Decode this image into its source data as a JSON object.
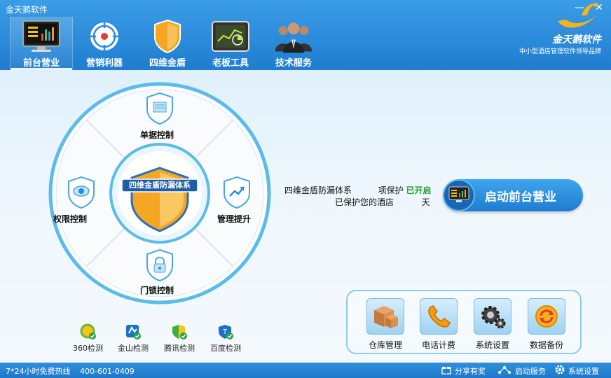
{
  "window": {
    "title": "金天鹅软件",
    "min_symbol": "—",
    "close_symbol": "✕"
  },
  "nav": {
    "tabs": [
      {
        "label": "前台营业",
        "icon": "monitor-chart-icon",
        "active": true
      },
      {
        "label": "营销利器",
        "icon": "target-icon",
        "active": false
      },
      {
        "label": "四维金盾",
        "icon": "shield-icon",
        "active": false
      },
      {
        "label": "老板工具",
        "icon": "dashboard-chart-icon",
        "active": false
      },
      {
        "label": "技术服务",
        "icon": "people-icon",
        "active": false
      }
    ]
  },
  "brand": {
    "name": "金天鹅软件",
    "slogan": "中小型酒店管理软件领导品牌"
  },
  "wheel": {
    "center_title": "四维金盾防漏体系",
    "top_label": "单据控制",
    "left_label": "权限控制",
    "right_label": "管理提升",
    "bottom_label": "门锁控制"
  },
  "status": {
    "line1_prefix": "四维金盾防漏体系",
    "line1_mid": "项保护",
    "line1_state": "已开启",
    "line2_prefix": "已保护您的酒店",
    "line2_suffix": "天"
  },
  "start_button": {
    "label": "启动前台营业"
  },
  "tools": [
    {
      "label": "仓库管理",
      "icon": "boxes-icon"
    },
    {
      "label": "电话计费",
      "icon": "phone-icon"
    },
    {
      "label": "系统设置",
      "icon": "gears-icon"
    },
    {
      "label": "数据备份",
      "icon": "refresh-icon"
    }
  ],
  "checks": [
    {
      "label": "360检测",
      "icon": "360-check-icon"
    },
    {
      "label": "金山检测",
      "icon": "kingsoft-check-icon"
    },
    {
      "label": "腾讯检测",
      "icon": "tencent-check-icon"
    },
    {
      "label": "百度检测",
      "icon": "baidu-check-icon"
    }
  ],
  "footer": {
    "hotline_label": "7*24小时免费热线",
    "hotline_number": "400-601-0409",
    "share": "分享有奖",
    "start_service": "启动服务",
    "settings": "系统设置"
  },
  "colors": {
    "header_blue": "#2b8ad9",
    "accent_green": "#22a02e",
    "shield_gold": "#f5a623"
  }
}
